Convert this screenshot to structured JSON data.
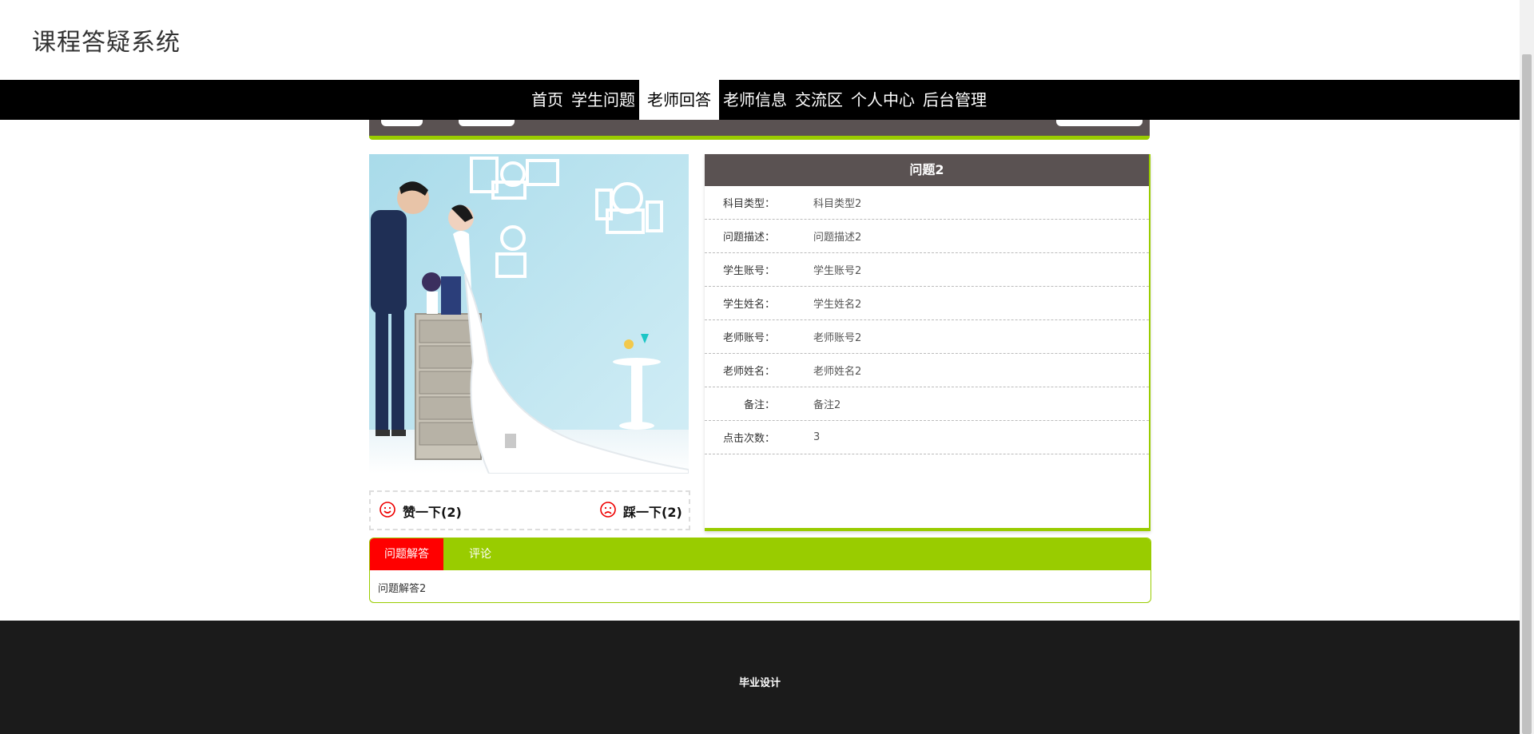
{
  "site": {
    "title": "课程答疑系统"
  },
  "nav": {
    "items": [
      {
        "label": "首页"
      },
      {
        "label": "学生问题"
      },
      {
        "label": "老师回答",
        "active": true
      },
      {
        "label": "老师信息"
      },
      {
        "label": "交流区"
      },
      {
        "label": "个人中心"
      },
      {
        "label": "后台管理"
      }
    ]
  },
  "detail": {
    "title": "问题2",
    "fields": [
      {
        "key": "科目类型：",
        "value": "科目类型2"
      },
      {
        "key": "问题描述：",
        "value": "问题描述2"
      },
      {
        "key": "学生账号：",
        "value": "学生账号2"
      },
      {
        "key": "学生姓名：",
        "value": "学生姓名2"
      },
      {
        "key": "老师账号：",
        "value": "老师账号2"
      },
      {
        "key": "老师姓名：",
        "value": "老师姓名2"
      },
      {
        "key": "备注：",
        "value": "备注2"
      },
      {
        "key": "点击次数：",
        "value": "3"
      }
    ]
  },
  "vote": {
    "like_label": "赞一下(2)",
    "dislike_label": "踩一下(2)"
  },
  "tabs": {
    "items": [
      {
        "label": "问题解答",
        "active": true
      },
      {
        "label": "评论"
      }
    ],
    "content": "问题解答2"
  },
  "footer": {
    "text": "毕业设计"
  },
  "colors": {
    "accent_green": "#99cc00",
    "header_brown": "#5a5252",
    "tab_active_red": "#ff0000",
    "nav_black": "#000000",
    "footer_dark": "#1b1b1b"
  }
}
